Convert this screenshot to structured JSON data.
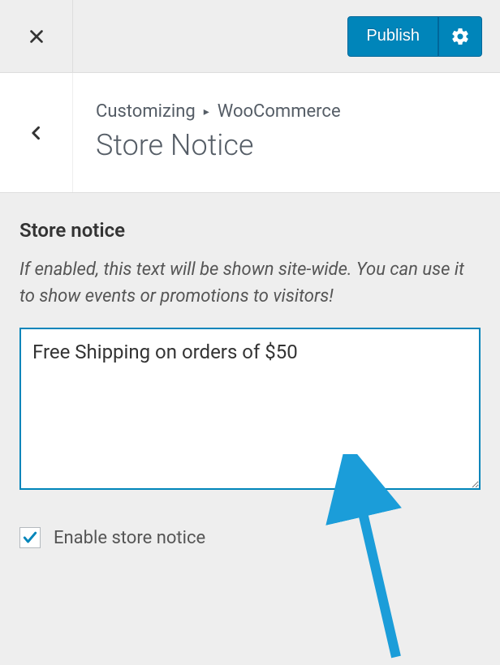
{
  "topbar": {
    "publish_label": "Publish"
  },
  "header": {
    "breadcrumb_parent": "Customizing",
    "breadcrumb_section": "WooCommerce",
    "page_title": "Store Notice"
  },
  "panel": {
    "field_label": "Store notice",
    "field_description": "If enabled, this text will be shown site-wide. You can use it to show events or promotions to visitors!",
    "field_value": "Free Shipping on orders of $50",
    "checkbox_label": "Enable store notice",
    "checkbox_checked": true
  },
  "colors": {
    "primary": "#0085ba",
    "arrow": "#1b9dd9"
  }
}
